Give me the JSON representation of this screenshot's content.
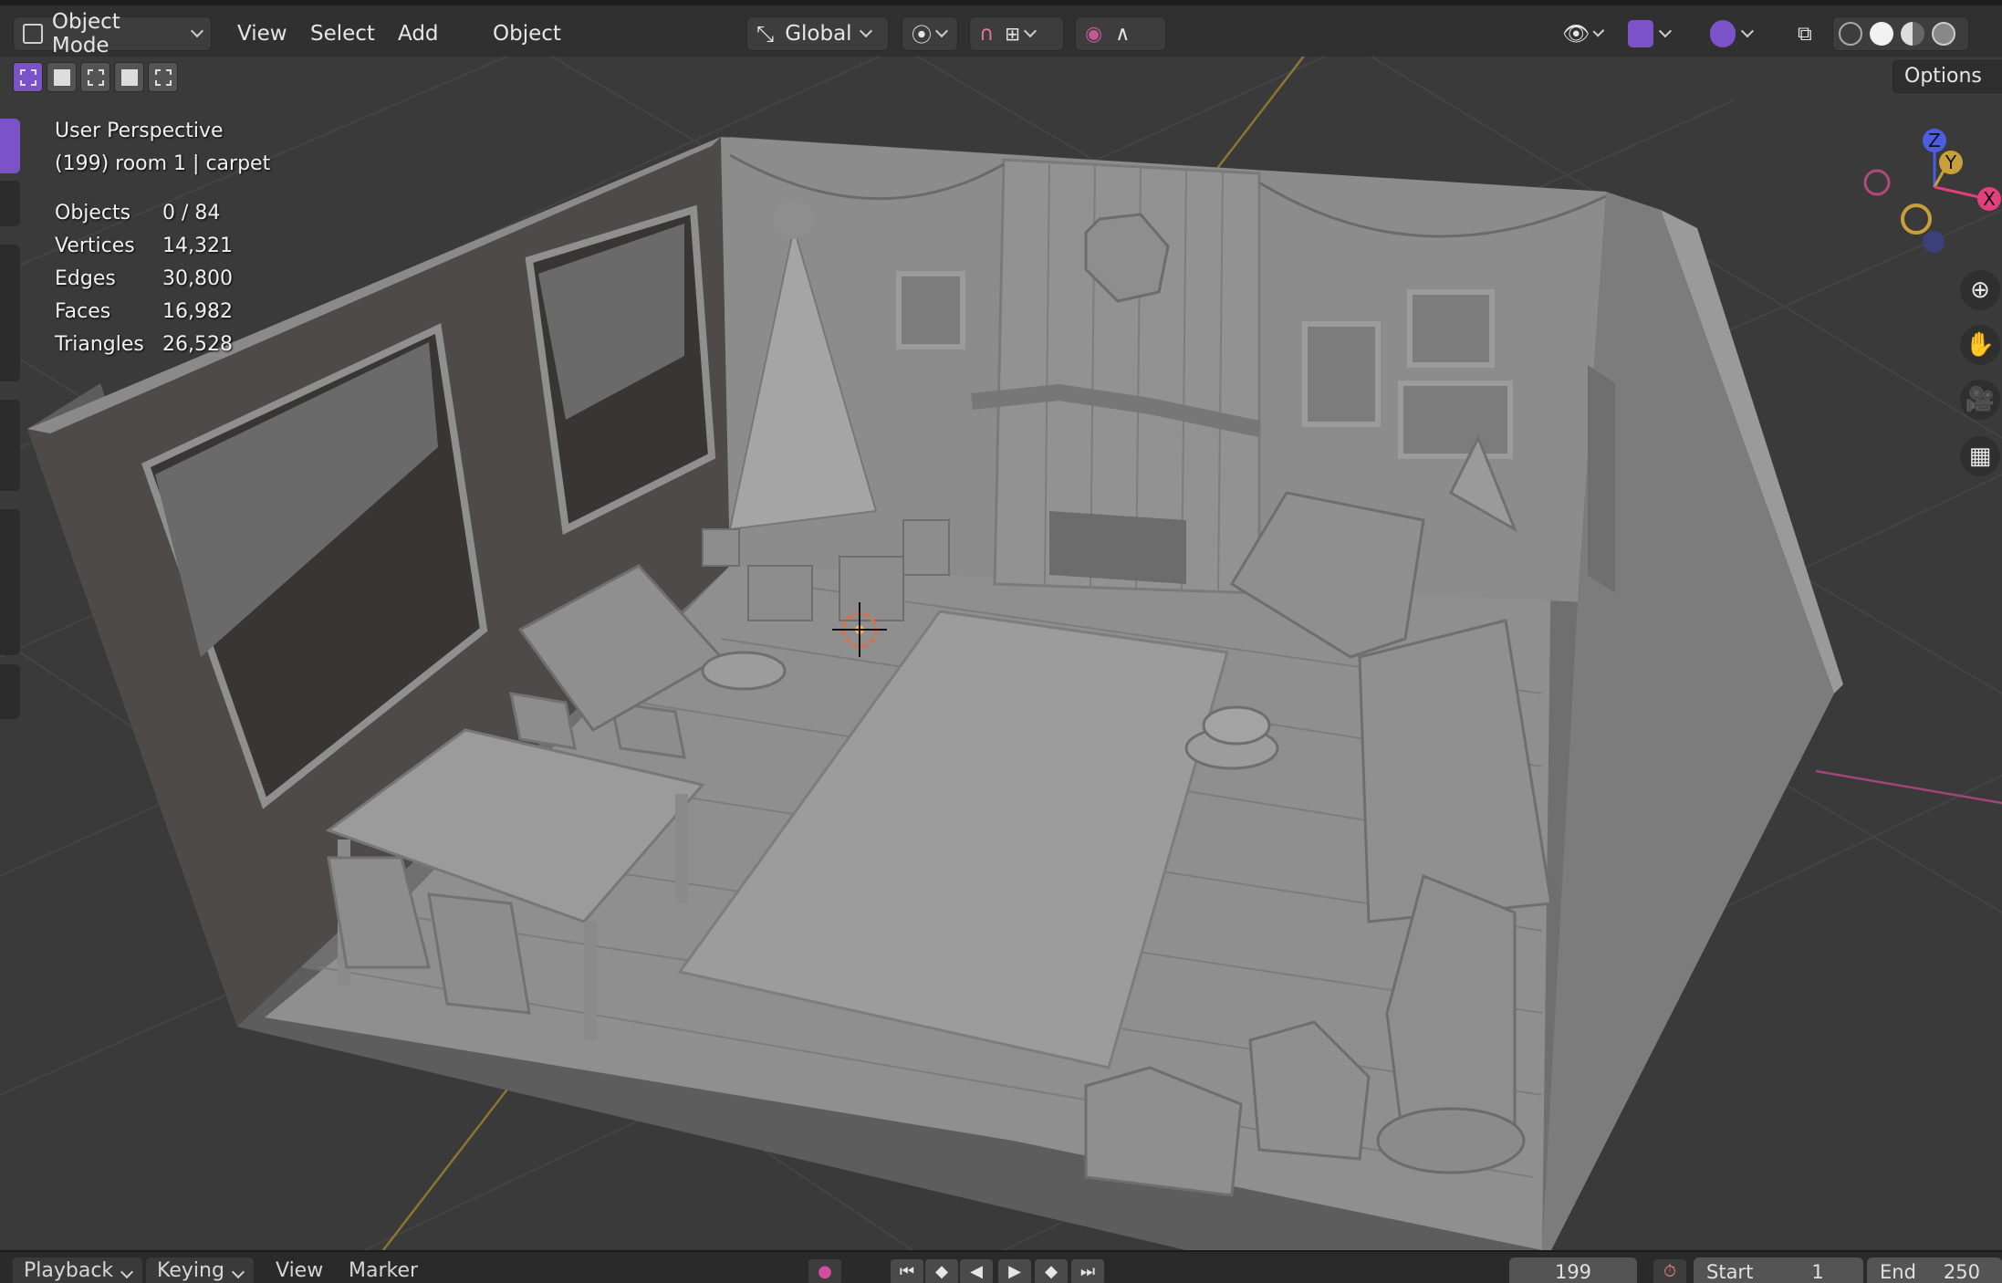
{
  "header": {
    "mode_label": "Object Mode",
    "menus": [
      "View",
      "Select",
      "Add",
      "Object"
    ],
    "transform_orientation": "Global",
    "options_label": "Options"
  },
  "overlay": {
    "view_name": "User Perspective",
    "active_object": "(199) room 1 | carpet",
    "stats": [
      {
        "label": "Objects",
        "value": "0 / 84"
      },
      {
        "label": "Vertices",
        "value": "14,321"
      },
      {
        "label": "Edges",
        "value": "30,800"
      },
      {
        "label": "Faces",
        "value": "16,982"
      },
      {
        "label": "Triangles",
        "value": "26,528"
      }
    ]
  },
  "gizmo": {
    "z_label": "Z",
    "y_label": "Y",
    "x_label": "X",
    "x_color": "#e2407c",
    "y_color": "#c8a03a",
    "z_color": "#4b5de0"
  },
  "nav_icons": [
    "zoom-icon",
    "hand-pan-icon",
    "camera-icon",
    "ortho-grid-icon"
  ],
  "timeline": {
    "playback_label": "Playback",
    "keying_label": "Keying",
    "view_label": "View",
    "marker_label": "Marker",
    "current_frame": "199",
    "start_label": "Start",
    "start_value": "1",
    "end_label": "End",
    "end_value": "250"
  },
  "colors": {
    "accent": "#7c52c9",
    "header_bg": "#303030",
    "viewport_bg": "#3a3a3a"
  }
}
